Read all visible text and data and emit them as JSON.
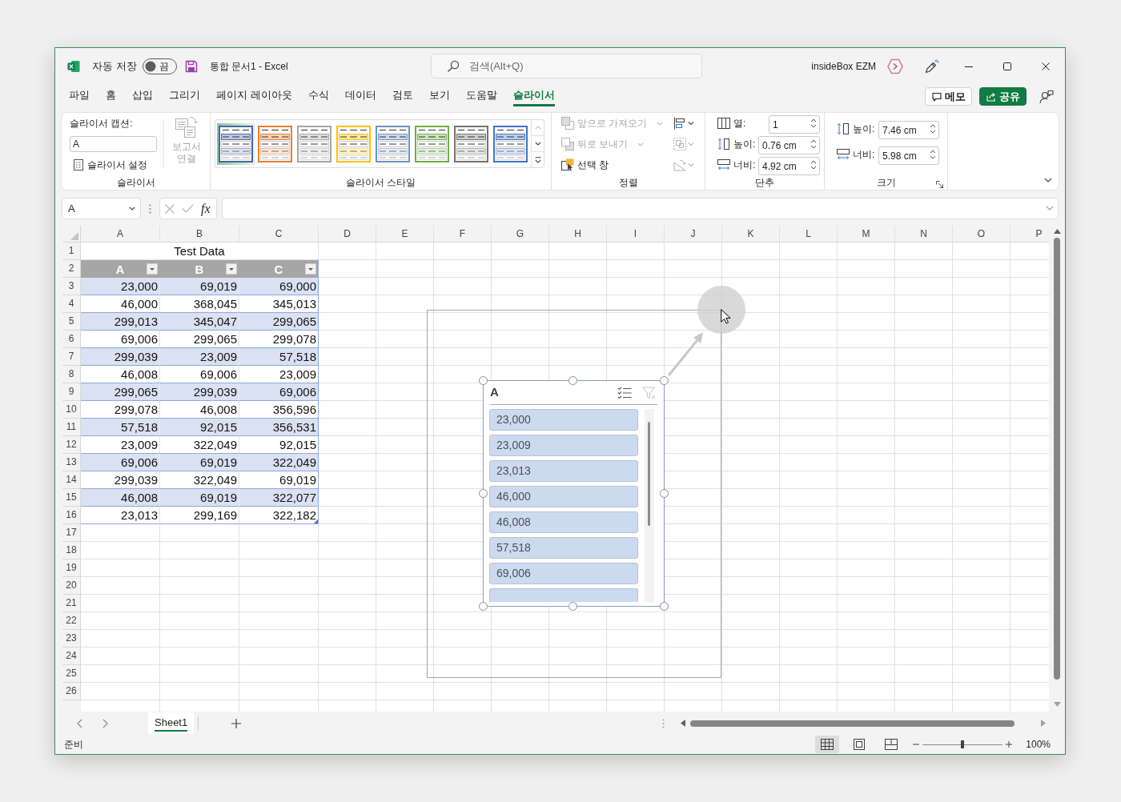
{
  "title_bar": {
    "autosave": {
      "label": "자동 저장",
      "on": false,
      "state_label": "끔"
    },
    "document_title": "통합 문서1 - Excel",
    "search": {
      "placeholder": "검색(Alt+Q)"
    },
    "account_name": "insideBox EZM"
  },
  "ribbon_tabs": [
    {
      "label": "파일",
      "selected": false
    },
    {
      "label": "홈",
      "selected": false
    },
    {
      "label": "삽입",
      "selected": false
    },
    {
      "label": "그리기",
      "selected": false
    },
    {
      "label": "페이지 레이아웃",
      "selected": false
    },
    {
      "label": "수식",
      "selected": false
    },
    {
      "label": "데이터",
      "selected": false
    },
    {
      "label": "검토",
      "selected": false
    },
    {
      "label": "보기",
      "selected": false
    },
    {
      "label": "도움말",
      "selected": false
    },
    {
      "label": "슬라이서",
      "selected": true
    }
  ],
  "header_buttons": [
    {
      "kind": "comments",
      "label": "메모"
    },
    {
      "kind": "share",
      "label": "공유"
    }
  ],
  "ribbon": {
    "slicer": {
      "caption_label": "슬라이서 캡션:",
      "caption_value": "A",
      "settings_label": "슬라이서 설정",
      "report_connections": {
        "label_lines": [
          "보고서",
          "연결"
        ],
        "disabled": true
      },
      "group_label": "슬라이서"
    },
    "slicer_styles": {
      "styles": [
        {
          "color": "#4a64a8",
          "selected": true
        },
        {
          "color": "#ed7d31",
          "selected": false
        },
        {
          "color": "#a5a5a5",
          "selected": false
        },
        {
          "color": "#ffc000",
          "selected": false
        },
        {
          "color": "#6e93c0",
          "selected": false
        },
        {
          "color": "#70ad47",
          "selected": false
        },
        {
          "color": "#737373",
          "selected": false
        },
        {
          "color": "#4472c4",
          "selected": false
        }
      ],
      "group_label": "슬라이서 스타일"
    },
    "arrange": {
      "commands": [
        {
          "kind": "bring_forward",
          "label": "앞으로 가져오기",
          "disabled": true,
          "dropdown": true
        },
        {
          "kind": "send_backward",
          "label": "뒤로 보내기",
          "disabled": true,
          "dropdown": true
        },
        {
          "kind": "selection_pane",
          "label": "선택 창",
          "disabled": false,
          "dropdown": false
        }
      ],
      "tools": [
        {
          "kind": "align",
          "disabled": false
        },
        {
          "kind": "group",
          "disabled": true
        },
        {
          "kind": "rotate",
          "disabled": true
        }
      ],
      "group_label": "정렬"
    },
    "buttons": {
      "fields": [
        {
          "kind": "columns",
          "label": "열:",
          "value": "1"
        },
        {
          "kind": "height",
          "label": "높이:",
          "value": "0.76 cm"
        },
        {
          "kind": "width",
          "label": "너비:",
          "value": "4.92 cm"
        }
      ],
      "group_label": "단추"
    },
    "size": {
      "fields": [
        {
          "kind": "height",
          "label": "높이:",
          "value": "7.46 cm"
        },
        {
          "kind": "width",
          "label": "너비:",
          "value": "5.98 cm"
        }
      ],
      "group_label": "크기"
    }
  },
  "formula_bar": {
    "name_box": "A",
    "function_label": "fx"
  },
  "sheet": {
    "columns": [
      "A",
      "B",
      "C",
      "D",
      "E",
      "F",
      "G",
      "H",
      "I",
      "J",
      "K",
      "L",
      "M",
      "N",
      "O",
      "P"
    ],
    "rows": [
      "1",
      "2",
      "3",
      "4",
      "5",
      "6",
      "7",
      "8",
      "9",
      "10",
      "11",
      "12",
      "13",
      "14",
      "15",
      "16",
      "17",
      "18",
      "19",
      "20",
      "21",
      "22",
      "23",
      "24",
      "25",
      "26"
    ],
    "table": {
      "title": "Test Data",
      "headers": [
        "A",
        "B",
        "C"
      ],
      "rows": [
        [
          "23,000",
          "69,019",
          "69,000"
        ],
        [
          "46,000",
          "368,045",
          "345,013"
        ],
        [
          "299,013",
          "345,047",
          "299,065"
        ],
        [
          "69,006",
          "299,065",
          "299,078"
        ],
        [
          "299,039",
          "23,009",
          "57,518"
        ],
        [
          "46,008",
          "69,006",
          "23,009"
        ],
        [
          "299,065",
          "299,039",
          "69,006"
        ],
        [
          "299,078",
          "46,008",
          "356,596"
        ],
        [
          "57,518",
          "92,015",
          "356,531"
        ],
        [
          "23,009",
          "322,049",
          "92,015"
        ],
        [
          "69,006",
          "69,019",
          "322,049"
        ],
        [
          "299,039",
          "322,049",
          "69,019"
        ],
        [
          "46,008",
          "69,019",
          "322,077"
        ],
        [
          "23,013",
          "299,169",
          "322,182"
        ]
      ]
    }
  },
  "slicer": {
    "selected": true,
    "title": "A",
    "tools": [
      {
        "kind": "multi_select",
        "disabled": false
      },
      {
        "kind": "clear_filter",
        "disabled": true
      }
    ],
    "items": [
      {
        "kind": "item",
        "label": "23,000",
        "selected": true
      },
      {
        "kind": "item",
        "label": "23,009",
        "selected": true
      },
      {
        "kind": "item",
        "label": "23,013",
        "selected": true
      },
      {
        "kind": "item",
        "label": "46,000",
        "selected": true
      },
      {
        "kind": "item",
        "label": "46,008",
        "selected": true
      },
      {
        "kind": "item",
        "label": "57,518",
        "selected": true
      },
      {
        "kind": "item",
        "label": "69,006",
        "selected": true
      },
      {
        "kind": "cut",
        "selected": true
      }
    ]
  },
  "sheet_tabs": [
    {
      "label": "Sheet1",
      "selected": true
    }
  ],
  "status_bar": {
    "status": "준비",
    "views": [
      {
        "kind": "normal",
        "selected": true
      },
      {
        "kind": "page_layout",
        "selected": false
      },
      {
        "kind": "page_break",
        "selected": false
      }
    ],
    "zoom": {
      "level": 0.5,
      "reading": "100%"
    }
  }
}
